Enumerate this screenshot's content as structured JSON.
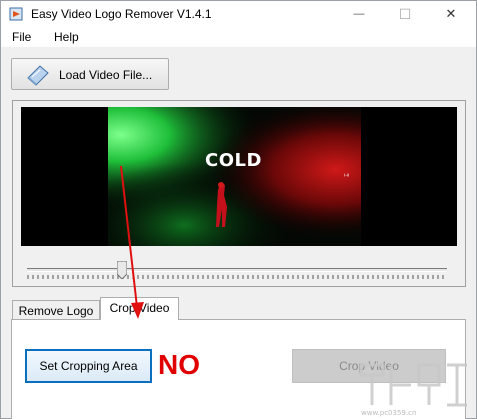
{
  "window": {
    "title": "Easy Video Logo Remover V1.4.1",
    "minimize_glyph": "—",
    "maximize_glyph": "☐",
    "close_glyph": "✕"
  },
  "menu": {
    "items": [
      "File",
      "Help"
    ]
  },
  "toolbar": {
    "load_label": "Load Video File...",
    "load_icon": "folder-book-icon"
  },
  "video": {
    "overlay_text": "COLD",
    "side_text": "ᵢ.ᵢᵢ"
  },
  "slider": {
    "position_fraction": 0.22
  },
  "tabs": [
    {
      "label": "Remove Logo",
      "active": false
    },
    {
      "label": "Crop Video",
      "active": true
    }
  ],
  "crop_panel": {
    "set_area_label": "Set Cropping Area",
    "annotation_text": "NO",
    "crop_video_label": "Crop Video"
  },
  "colors": {
    "annotation_red": "#e00000",
    "focus_blue": "#0b6fbf",
    "video_green": "#1fbf3a",
    "video_red": "#b01010"
  }
}
